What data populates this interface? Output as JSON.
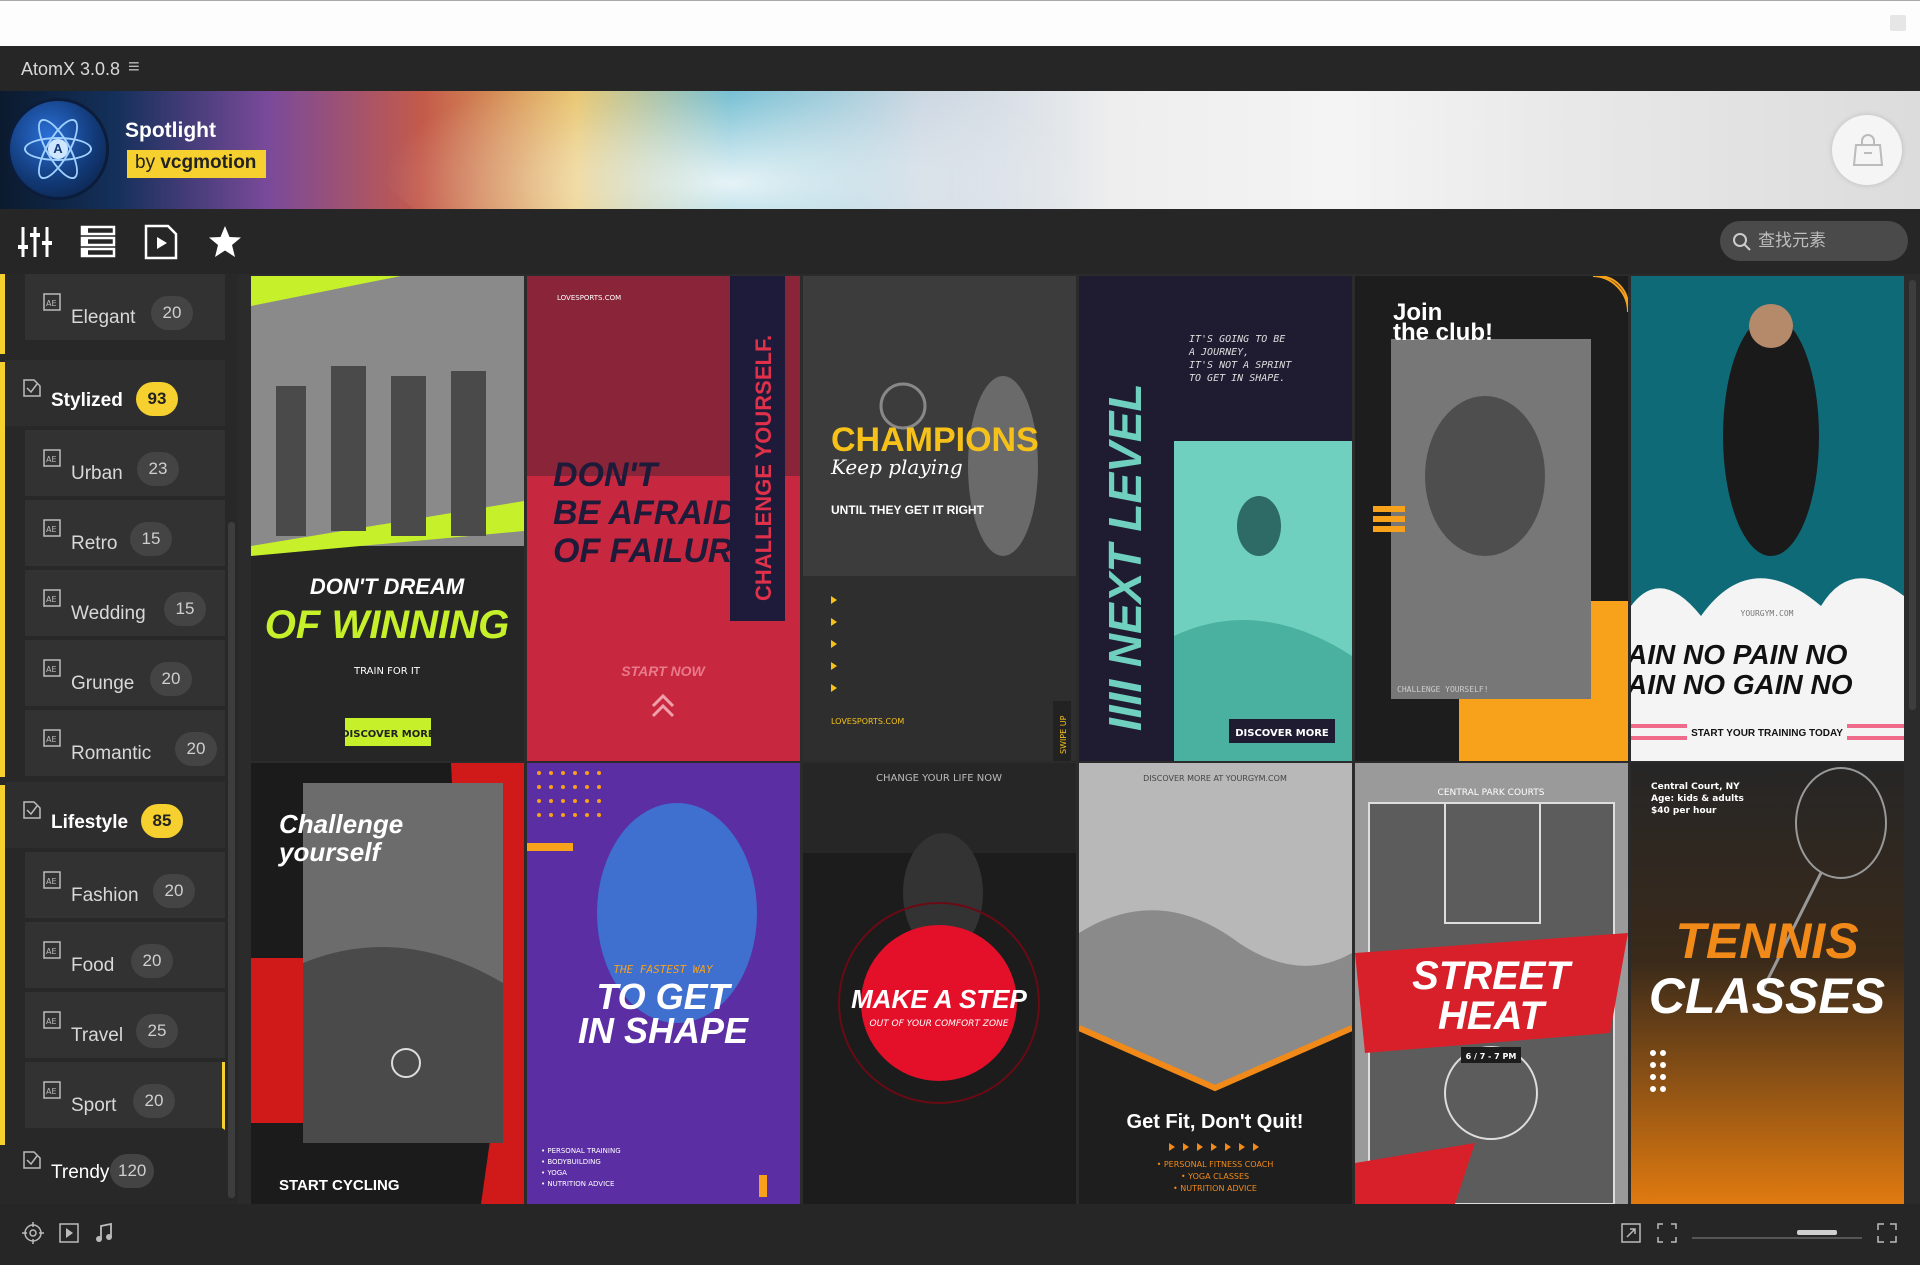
{
  "app": {
    "title": "AtomX 3.0.8",
    "menu_icon": "hamburger-icon"
  },
  "banner": {
    "pack_name": "Spotlight",
    "by_prefix": "by",
    "by_author": "vcgmotion",
    "cart_icon": "shopping-bag-icon"
  },
  "toolbar": {
    "icons": [
      "sliders-icon",
      "list-icon",
      "media-file-icon",
      "star-icon"
    ],
    "search_placeholder": "查找元素"
  },
  "sidebar": {
    "items": [
      {
        "label": "Elegant",
        "count": "20",
        "level": "sub"
      },
      {
        "label": "Stylized",
        "count": "93",
        "level": "top"
      },
      {
        "label": "Urban",
        "count": "23",
        "level": "sub"
      },
      {
        "label": "Retro",
        "count": "15",
        "level": "sub"
      },
      {
        "label": "Wedding",
        "count": "15",
        "level": "sub"
      },
      {
        "label": "Grunge",
        "count": "20",
        "level": "sub"
      },
      {
        "label": "Romantic",
        "count": "20",
        "level": "sub"
      },
      {
        "label": "Lifestyle",
        "count": "85",
        "level": "top"
      },
      {
        "label": "Fashion",
        "count": "20",
        "level": "sub"
      },
      {
        "label": "Food",
        "count": "20",
        "level": "sub"
      },
      {
        "label": "Travel",
        "count": "25",
        "level": "sub"
      },
      {
        "label": "Sport",
        "count": "20",
        "level": "sub"
      },
      {
        "label": "Trendy",
        "count": "120",
        "level": "top"
      }
    ]
  },
  "colors": {
    "accent": "#f6d02e",
    "bg": "#2b2b2b",
    "panel": "#262626"
  },
  "cards": [
    {
      "lines": [
        "DON'T DREAM",
        "OF WINNING",
        "TRAIN FOR IT",
        "DISCOVER MORE"
      ]
    },
    {
      "lines": [
        "LOVESPORTS.COM",
        "DON'T",
        "BE AFRAID",
        "OF FAILURE",
        "CHALLENGE YOURSELF.",
        "START NOW"
      ]
    },
    {
      "lines": [
        "CHAMPIONS",
        "Keep playing",
        "UNTIL THEY GET IT RIGHT",
        "LOVESPORTS.COM",
        "SWIPE UP"
      ]
    },
    {
      "lines": [
        "IIII NEXT LEVEL",
        "IT'S GOING TO BE",
        "A JOURNEY,",
        "IT'S NOT A SPRINT",
        "TO GET IN SHAPE.",
        "DISCOVER MORE"
      ]
    },
    {
      "lines": [
        "Join",
        "the club!",
        "CHALLENGE YOURSELF!"
      ]
    },
    {
      "lines": [
        "YOURGYM.COM",
        "AIN NO PAIN NO",
        "AIN NO GAIN NO",
        "START YOUR TRAINING TODAY"
      ]
    },
    {
      "lines": [
        "Challenge",
        "yourself",
        "START CYCLING"
      ]
    },
    {
      "lines": [
        "THE FASTEST WAY",
        "TO GET",
        "IN SHAPE",
        "• PERSONAL TRAINING",
        "• BODYBUILDING",
        "• YOGA",
        "• NUTRITION ADVICE"
      ]
    },
    {
      "lines": [
        "CHANGE YOUR LIFE NOW",
        "MAKE A STEP",
        "OUT OF YOUR COMFORT ZONE"
      ]
    },
    {
      "lines": [
        "DISCOVER MORE AT YOURGYM.COM",
        "Get Fit, Don't Quit!",
        "• PERSONAL FITNESS COACH",
        "• YOGA CLASSES",
        "• NUTRITION ADVICE"
      ]
    },
    {
      "lines": [
        "CENTRAL PARK COURTS",
        "STREET",
        "HEAT",
        "6 / 7 - 7 PM"
      ]
    },
    {
      "lines": [
        "Central Court, NY",
        "Age: kids & adults",
        "$40 per hour",
        "TENNIS",
        "CLASSES"
      ]
    }
  ]
}
